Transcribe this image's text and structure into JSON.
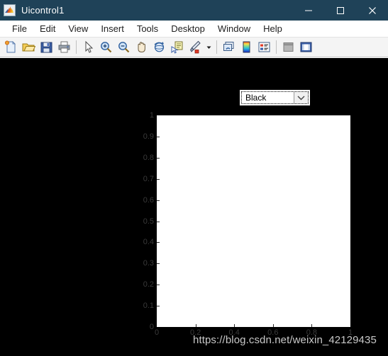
{
  "window": {
    "title": "Uicontrol1",
    "icon": "matlab-icon",
    "titlebar_color": "#1f4258",
    "controls": {
      "minimize": "minimize-icon",
      "maximize": "maximize-icon",
      "close": "close-icon"
    }
  },
  "menubar": {
    "items": [
      {
        "label": "File"
      },
      {
        "label": "Edit"
      },
      {
        "label": "View"
      },
      {
        "label": "Insert"
      },
      {
        "label": "Tools"
      },
      {
        "label": "Desktop"
      },
      {
        "label": "Window"
      },
      {
        "label": "Help"
      }
    ]
  },
  "toolbar": {
    "buttons": [
      {
        "name": "new-figure-icon"
      },
      {
        "name": "open-file-icon"
      },
      {
        "name": "save-figure-icon"
      },
      {
        "name": "print-figure-icon"
      },
      {
        "name": "separator"
      },
      {
        "name": "pointer-arrow-icon"
      },
      {
        "name": "zoom-in-icon"
      },
      {
        "name": "zoom-out-icon"
      },
      {
        "name": "pan-hand-icon"
      },
      {
        "name": "rotate-3d-icon"
      },
      {
        "name": "data-cursor-icon"
      },
      {
        "name": "brush-icon"
      },
      {
        "name": "brush-dropdown-arrow-icon"
      },
      {
        "name": "separator"
      },
      {
        "name": "link-plot-icon"
      },
      {
        "name": "colorbar-icon"
      },
      {
        "name": "legend-icon"
      },
      {
        "name": "separator"
      },
      {
        "name": "hide-plot-tools-icon"
      },
      {
        "name": "show-plot-tools-icon"
      }
    ]
  },
  "figure": {
    "background": "#000000",
    "color_popup": {
      "name": "color-select-dropdown",
      "value": "Black",
      "options": [
        "Black"
      ],
      "arrow": "chevron-down-icon"
    },
    "axes": {
      "background": "#ffffff",
      "xlim": [
        0,
        1
      ],
      "ylim": [
        0,
        1
      ],
      "xticks": [
        "0",
        "0.2",
        "0.4",
        "0.6",
        "0.8",
        "1"
      ],
      "yticks": [
        "0",
        "0.1",
        "0.2",
        "0.3",
        "0.4",
        "0.5",
        "0.6",
        "0.7",
        "0.8",
        "0.9",
        "1"
      ],
      "tick_color": "#3a3a3a"
    },
    "watermark": "https://blog.csdn.net/weixin_42129435"
  },
  "chart_data": {
    "type": "line",
    "title": "",
    "xlabel": "",
    "ylabel": "",
    "xlim": [
      0,
      1
    ],
    "ylim": [
      0,
      1
    ],
    "xticks": [
      0,
      0.2,
      0.4,
      0.6,
      0.8,
      1
    ],
    "yticks": [
      0,
      0.1,
      0.2,
      0.3,
      0.4,
      0.5,
      0.6,
      0.7,
      0.8,
      0.9,
      1
    ],
    "grid": false,
    "legend": false,
    "series": [],
    "x": [],
    "values": []
  }
}
